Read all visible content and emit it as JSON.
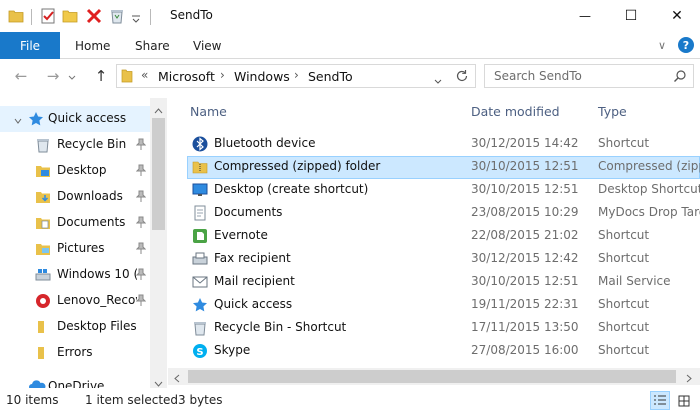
{
  "window": {
    "title": "SendTo",
    "minimize_glyph": "—",
    "maximize_glyph": "☐",
    "close_glyph": "✕"
  },
  "quick_access_toolbar": {
    "icons": [
      "folder-icon",
      "properties-checklist-icon",
      "new-folder-icon",
      "delete-x-icon",
      "recycle-bin-icon",
      "customize-chevron-icon"
    ],
    "accent": "#1979ca"
  },
  "ribbon": {
    "tabs": [
      "File",
      "Home",
      "Share",
      "View"
    ],
    "expand_glyph": "∨",
    "help_glyph": "?"
  },
  "address": {
    "breadcrumbs": [
      "Microsoft",
      "Windows",
      "SendTo"
    ],
    "overflow_glyph": "«",
    "separator": "›",
    "search_placeholder": "Search SendTo",
    "back_glyph": "←",
    "forward_glyph": "→",
    "up_glyph": "↑"
  },
  "nav_pane": {
    "items": [
      {
        "label": "Quick access",
        "icon": "star-icon",
        "pinned": false,
        "selected": true
      },
      {
        "label": "Recycle Bin",
        "icon": "recycle-bin-icon",
        "pinned": true
      },
      {
        "label": "Desktop",
        "icon": "desktop-folder-icon",
        "pinned": true
      },
      {
        "label": "Downloads",
        "icon": "downloads-folder-icon",
        "pinned": true
      },
      {
        "label": "Documents",
        "icon": "documents-folder-icon",
        "pinned": true
      },
      {
        "label": "Pictures",
        "icon": "pictures-folder-icon",
        "pinned": true
      },
      {
        "label": "Windows 10 (",
        "icon": "drive-icon",
        "pinned": true
      },
      {
        "label": "Lenovo_Recov",
        "icon": "lenovo-drive-icon",
        "pinned": true
      },
      {
        "label": "Desktop Files",
        "icon": "folder-icon",
        "pinned": false
      },
      {
        "label": "Errors",
        "icon": "folder-icon",
        "pinned": false
      },
      {
        "label": "OneDrive",
        "icon": "onedrive-icon",
        "pinned": false
      }
    ]
  },
  "columns": {
    "name": "Name",
    "date": "Date modified",
    "type": "Type"
  },
  "files": [
    {
      "name": "Bluetooth device",
      "date": "30/12/2015 14:42",
      "type": "Shortcut",
      "icon": "bluetooth-icon",
      "selected": false
    },
    {
      "name": "Compressed (zipped) folder",
      "date": "30/10/2015 12:51",
      "type": "Compressed (zipp",
      "icon": "zip-folder-icon",
      "selected": true
    },
    {
      "name": "Desktop (create shortcut)",
      "date": "30/10/2015 12:51",
      "type": "Desktop Shortcut",
      "icon": "desktop-icon",
      "selected": false
    },
    {
      "name": "Documents",
      "date": "23/08/2015 10:29",
      "type": "MyDocs Drop Targ",
      "icon": "documents-icon",
      "selected": false
    },
    {
      "name": "Evernote",
      "date": "22/08/2015 21:02",
      "type": "Shortcut",
      "icon": "evernote-icon",
      "selected": false
    },
    {
      "name": "Fax recipient",
      "date": "30/12/2015 12:42",
      "type": "Shortcut",
      "icon": "fax-icon",
      "selected": false
    },
    {
      "name": "Mail recipient",
      "date": "30/10/2015 12:51",
      "type": "Mail Service",
      "icon": "mail-icon",
      "selected": false
    },
    {
      "name": "Quick access",
      "date": "19/11/2015 22:31",
      "type": "Shortcut",
      "icon": "quick-access-star-icon",
      "selected": false
    },
    {
      "name": "Recycle Bin - Shortcut",
      "date": "17/11/2015 13:50",
      "type": "Shortcut",
      "icon": "recycle-bin-icon",
      "selected": false
    },
    {
      "name": "Skype",
      "date": "27/08/2015 16:00",
      "type": "Shortcut",
      "icon": "skype-icon",
      "selected": false
    }
  ],
  "status": {
    "count": "10 items",
    "selection": "1 item selected",
    "size": "3 bytes"
  },
  "colors": {
    "file_tab": "#1979ca",
    "selection_fill": "#cce8ff",
    "selection_border": "#99d1ff",
    "column_header": "#4d6082",
    "folder_yellow": "#e9c14a"
  }
}
